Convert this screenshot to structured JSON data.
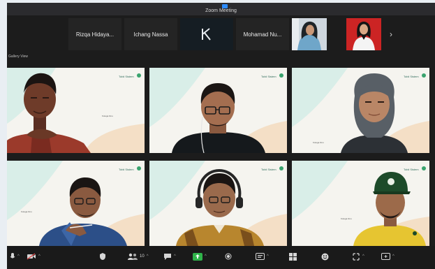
{
  "window": {
    "title": "Zoom Meeting"
  },
  "top_strip": {
    "participants": [
      {
        "type": "name",
        "name": "Rizqa Hidaya..."
      },
      {
        "type": "name",
        "name": "Ichang Nassa"
      },
      {
        "type": "avatar",
        "initial": "K"
      },
      {
        "type": "name",
        "name": "Mohamad Nu..."
      },
      {
        "type": "video",
        "name": "participant-hijab"
      },
      {
        "type": "video",
        "name": "participant-red-background"
      }
    ],
    "next_label": "›"
  },
  "view_label": "Gallery View",
  "gallery": {
    "tiles": [
      {
        "id": "tile-1",
        "active": false
      },
      {
        "id": "tile-2",
        "active": false
      },
      {
        "id": "tile-3",
        "active": false
      },
      {
        "id": "tile-4",
        "active": true
      },
      {
        "id": "tile-5",
        "active": false
      },
      {
        "id": "tile-6",
        "active": false
      }
    ]
  },
  "toolbar": {
    "items": [
      {
        "name": "mute-icon",
        "caret": "^"
      },
      {
        "name": "video-icon",
        "caret": "^"
      },
      {
        "name": "security-icon",
        "caret": ""
      },
      {
        "name": "participants-icon",
        "badge": "10",
        "caret": "^"
      },
      {
        "name": "chat-icon",
        "caret": "^"
      },
      {
        "name": "share-screen-icon",
        "caret": "^"
      },
      {
        "name": "record-icon",
        "caret": ""
      },
      {
        "name": "captions-icon",
        "caret": "^"
      },
      {
        "name": "breakout-rooms-icon",
        "caret": ""
      },
      {
        "name": "reactions-icon",
        "caret": ""
      },
      {
        "name": "apps-icon",
        "caret": "^"
      },
      {
        "name": "more-icon",
        "caret": "^"
      }
    ]
  },
  "colors": {
    "active_speaker": "#5cc46d",
    "zoom_blue": "#2d8cff",
    "share_green": "#2fb34a"
  }
}
